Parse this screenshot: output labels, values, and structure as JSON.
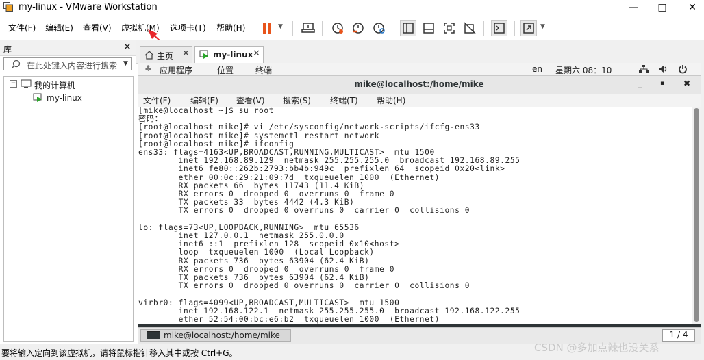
{
  "window": {
    "title": "my-linux - VMware Workstation",
    "controls": [
      "—",
      "□",
      "✕"
    ]
  },
  "menu": [
    {
      "label": "文件(F)"
    },
    {
      "label": "编辑(E)"
    },
    {
      "label": "查看(V)"
    },
    {
      "label": "虚拟机(M)"
    },
    {
      "label": "选项卡(T)"
    },
    {
      "label": "帮助(H)"
    }
  ],
  "toolbar": {
    "icons": [
      "pause-icon",
      "send-ctrl-alt-del-icon",
      "snapshot-icon",
      "revert-snapshot-icon",
      "snapshot-manager-icon",
      "show-library-icon",
      "thumbnail-bar-icon",
      "fullscreen-icon",
      "unity-icon",
      "console-view-icon",
      "stretch-icon"
    ],
    "accent_color": "#e8541b"
  },
  "library": {
    "title": "库",
    "close": "✕",
    "search_placeholder": "在此处键入内容进行搜索",
    "tree": {
      "root_label": "我的计算机",
      "root_toggle": "−",
      "child_label": "my-linux"
    }
  },
  "tabs": [
    {
      "label": "主页",
      "close": "✕"
    },
    {
      "label": "my-linux",
      "close": "✕"
    }
  ],
  "guest": {
    "topbar": {
      "applications": "应用程序",
      "places": "位置",
      "terminal": "终端",
      "lang": "en",
      "datetime": "星期六 08：10"
    },
    "terminal": {
      "title": "mike@localhost:/home/mike",
      "controls": [
        "_",
        "▪",
        "✖"
      ],
      "menu": [
        "文件(F)",
        "编辑(E)",
        "查看(V)",
        "搜索(S)",
        "终端(T)",
        "帮助(H)"
      ],
      "lines": [
        "[mike@localhost ~]$ su root",
        "密码：",
        "[root@localhost mike]# vi /etc/sysconfig/network-scripts/ifcfg-ens33",
        "[root@localhost mike]# systemctl restart network",
        "[root@localhost mike]# ifconfig",
        "ens33: flags=4163<UP,BROADCAST,RUNNING,MULTICAST>  mtu 1500",
        "        inet 192.168.89.129  netmask 255.255.255.0  broadcast 192.168.89.255",
        "        inet6 fe80::262b:2793:bb4b:949c  prefixlen 64  scopeid 0x20<link>",
        "        ether 00:0c:29:21:09:7d  txqueuelen 1000  (Ethernet)",
        "        RX packets 66  bytes 11743 (11.4 KiB)",
        "        RX errors 0  dropped 0  overruns 0  frame 0",
        "        TX packets 33  bytes 4442 (4.3 KiB)",
        "        TX errors 0  dropped 0 overruns 0  carrier 0  collisions 0",
        "",
        "lo: flags=73<UP,LOOPBACK,RUNNING>  mtu 65536",
        "        inet 127.0.0.1  netmask 255.0.0.0",
        "        inet6 ::1  prefixlen 128  scopeid 0x10<host>",
        "        loop  txqueuelen 1000  (Local Loopback)",
        "        RX packets 736  bytes 63904 (62.4 KiB)",
        "        RX errors 0  dropped 0  overruns 0  frame 0",
        "        TX packets 736  bytes 63904 (62.4 KiB)",
        "        TX errors 0  dropped 0 overruns 0  carrier 0  collisions 0",
        "",
        "virbr0: flags=4099<UP,BROADCAST,MULTICAST>  mtu 1500",
        "        inet 192.168.122.1  netmask 255.255.255.0  broadcast 192.168.122.255",
        "        ether 52:54:00:bc:e6:b2  txqueuelen 1000  (Ethernet)"
      ]
    },
    "bottombar": {
      "window_item": "mike@localhost:/home/mike",
      "workspace": "1 / 4"
    }
  },
  "statusbar": {
    "text": "要将输入定向到该虚拟机，请将鼠标指针移入其中或按 Ctrl+G。",
    "watermark": "CSDN @多加点辣也没关系"
  }
}
